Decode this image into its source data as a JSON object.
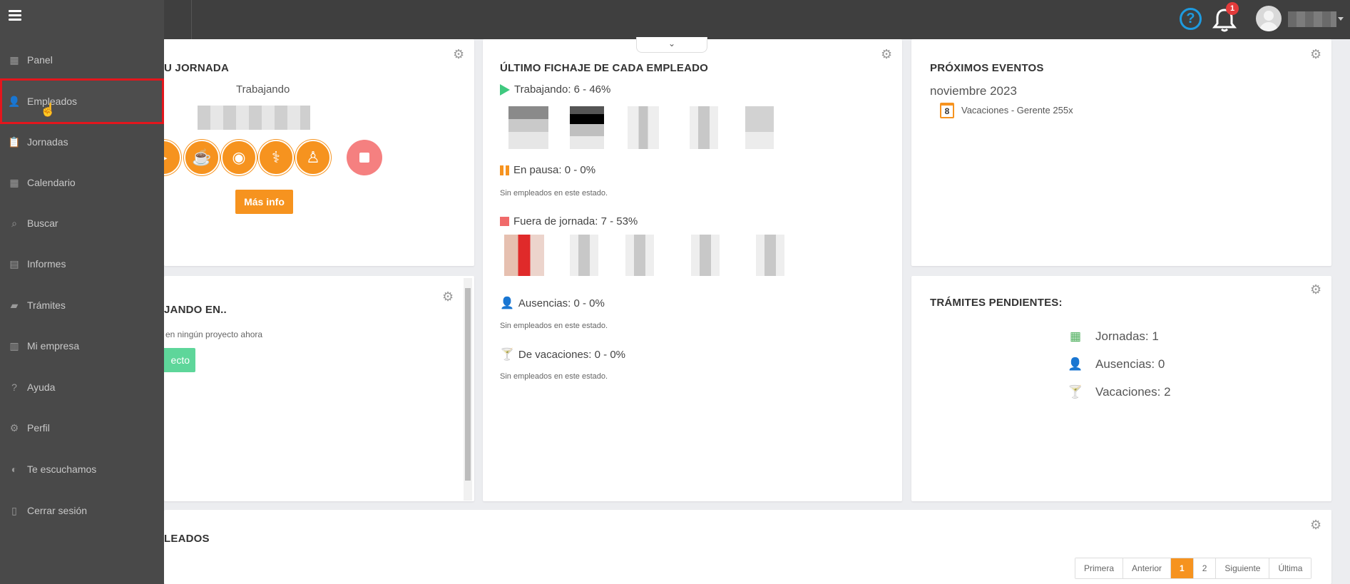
{
  "topbar": {
    "help_glyph": "?",
    "notifications_count": "1",
    "icons": {
      "help": "help-circle-icon",
      "bell": "bell-icon",
      "avatar": "user-avatar-icon"
    }
  },
  "sidebar": {
    "items": [
      {
        "label": "Panel",
        "icon": "dashboard-icon",
        "glyph": "▦"
      },
      {
        "label": "Empleados",
        "icon": "user-icon",
        "glyph": "👤"
      },
      {
        "label": "Jornadas",
        "icon": "clipboard-icon",
        "glyph": "📋"
      },
      {
        "label": "Calendario",
        "icon": "calendar-icon",
        "glyph": "▦"
      },
      {
        "label": "Buscar",
        "icon": "search-icon",
        "glyph": "⌕"
      },
      {
        "label": "Informes",
        "icon": "report-icon",
        "glyph": "▤"
      },
      {
        "label": "Trámites",
        "icon": "folder-icon",
        "glyph": "▰"
      },
      {
        "label": "Mi empresa",
        "icon": "building-icon",
        "glyph": "▥"
      },
      {
        "label": "Ayuda",
        "icon": "help-icon",
        "glyph": "?"
      },
      {
        "label": "Perfil",
        "icon": "gear-icon",
        "glyph": "⚙"
      },
      {
        "label": "Te escuchamos",
        "icon": "ear-icon",
        "glyph": "◐"
      },
      {
        "label": "Cerrar sesión",
        "icon": "logout-icon",
        "glyph": "▯"
      }
    ],
    "active_item": "Empleados"
  },
  "jornada_card": {
    "title": "U JORNADA",
    "status": "Trabajando",
    "more_info_label": "Más info",
    "action_icons": [
      "play-icon",
      "coffee-icon",
      "lunch-icon",
      "doctor-icon",
      "family-icon",
      "stop-icon"
    ]
  },
  "proyecto_card": {
    "title": "JANDO EN..",
    "note": "en ningún proyecto ahora",
    "button_label": "ecto"
  },
  "fichaje_card": {
    "title": "ÚLTIMO FICHAJE DE CADA EMPLEADO",
    "working": "Trabajando: 6 - 46%",
    "paused": "En pausa: 0 - 0%",
    "paused_note": "Sin empleados en este estado.",
    "off": "Fuera de jornada: 7 - 53%",
    "absences": "Ausencias: 0 - 0%",
    "absences_note": "Sin empleados en este estado.",
    "vacation": "De vacaciones: 0 - 0%",
    "vacation_note": "Sin empleados en este estado.",
    "collapse_glyph": "⌄"
  },
  "eventos_card": {
    "title": "PRÓXIMOS EVENTOS",
    "month": "noviembre 2023",
    "event_day": "8",
    "event_text": "Vacaciones - Gerente 255x"
  },
  "tramites_card": {
    "title": "TRÁMITES PENDIENTES:",
    "rows": [
      {
        "label": "Jornadas: 1",
        "icon": "calendar-icon",
        "color": "#4cae5b"
      },
      {
        "label": "Ausencias: 0",
        "icon": "user-clock-icon",
        "color": "#f6931f"
      },
      {
        "label": "Vacaciones: 2",
        "icon": "cocktail-icon",
        "color": "#f6931f"
      }
    ]
  },
  "empleados_card": {
    "title": "LEADOS",
    "pager": [
      "Primera",
      "Anterior",
      "1",
      "2",
      "Siguiente",
      "Última"
    ],
    "current_page": "1"
  },
  "colors": {
    "accent": "#f6931f",
    "working": "#3fc97f",
    "off": "#f06a6a",
    "stop": "#f58080",
    "highlight": "#e3161d",
    "help_blue": "#1e9be0"
  }
}
